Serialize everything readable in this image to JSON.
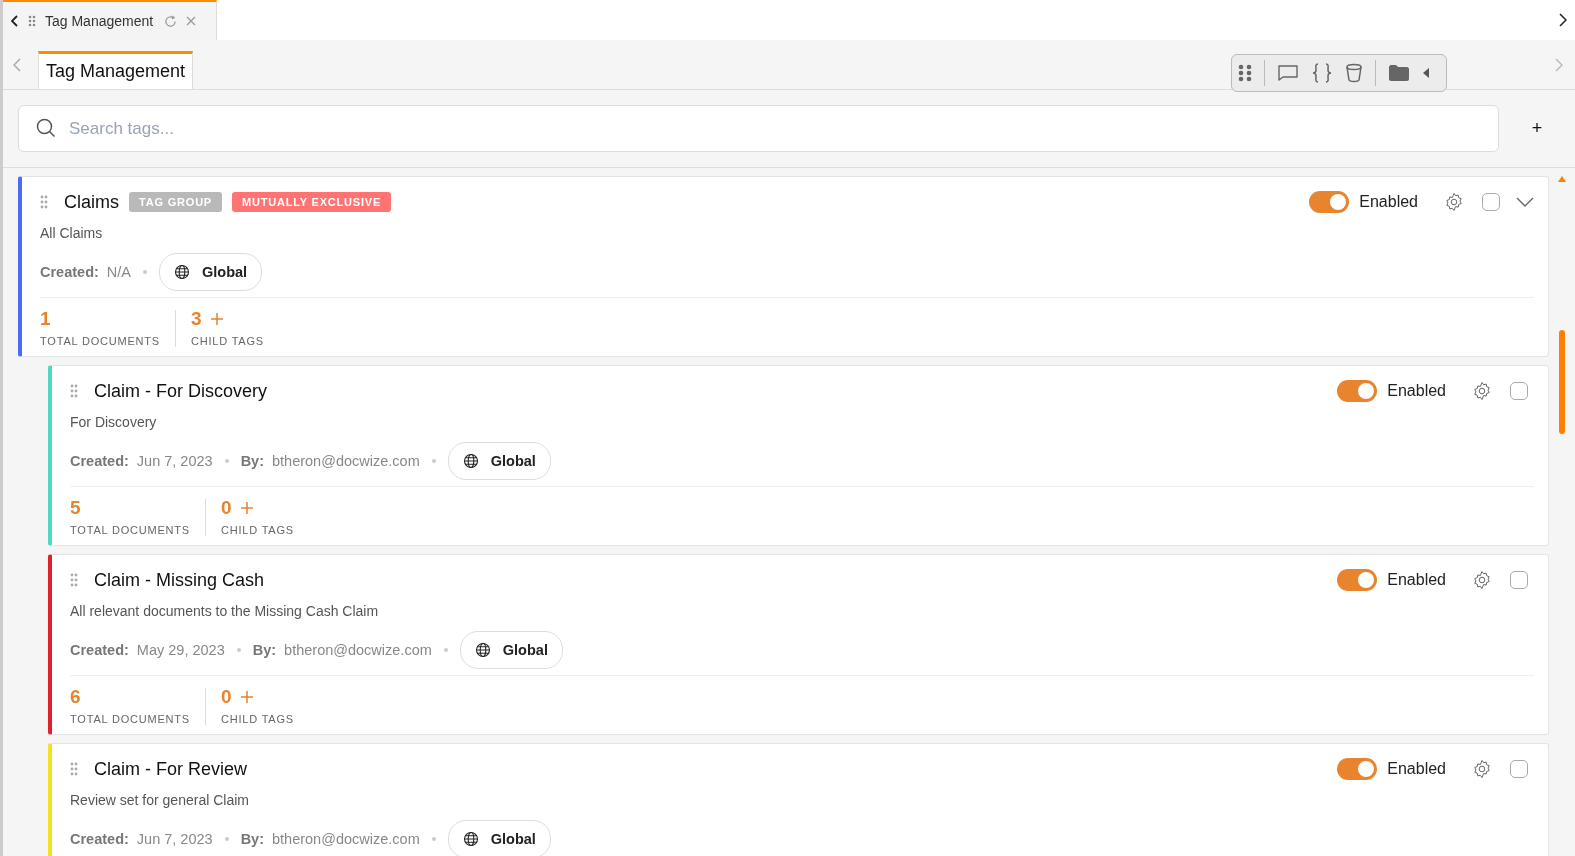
{
  "top_tab": {
    "title": "Tag Management"
  },
  "page_tab": {
    "label": "Tag Management",
    "selected": true
  },
  "search": {
    "placeholder": "Search tags..."
  },
  "add_button": "+",
  "tags": [
    {
      "name": "Claims",
      "badges": [
        {
          "text": "TAG GROUP",
          "kind": "group"
        },
        {
          "text": "MUTUALLY EXCLUSIVE",
          "kind": "exclusive"
        }
      ],
      "description": "All Claims",
      "created_label": "Created:",
      "created": "N/A",
      "scope": "Global",
      "total_documents": "1",
      "total_label": "TOTAL DOCUMENTS",
      "child_tags": "3",
      "child_label": "CHILD TAGS",
      "enabled": true,
      "status": "Enabled",
      "checked": false,
      "expanded": true,
      "color": "#4a6cf7",
      "children": [
        {
          "name": "Claim - For Discovery",
          "description": "For Discovery",
          "created_label": "Created:",
          "created": "Jun 7, 2023",
          "by_label": "By:",
          "by": "btheron@docwize.com",
          "scope": "Global",
          "total_documents": "5",
          "total_label": "TOTAL DOCUMENTS",
          "child_tags": "0",
          "child_label": "CHILD TAGS",
          "enabled": true,
          "status": "Enabled",
          "checked": false,
          "color": "#4fd8c4"
        },
        {
          "name": "Claim - Missing Cash",
          "description": "All relevant documents to the Missing Cash Claim",
          "created_label": "Created:",
          "created": "May 29, 2023",
          "by_label": "By:",
          "by": "btheron@docwize.com",
          "scope": "Global",
          "total_documents": "6",
          "total_label": "TOTAL DOCUMENTS",
          "child_tags": "0",
          "child_label": "CHILD TAGS",
          "enabled": true,
          "status": "Enabled",
          "checked": false,
          "color": "#e0202a"
        },
        {
          "name": "Claim - For Review",
          "description": "Review set for general Claim",
          "created_label": "Created:",
          "created": "Jun 7, 2023",
          "by_label": "By:",
          "by": "btheron@docwize.com",
          "scope": "Global",
          "enabled": true,
          "status": "Enabled",
          "checked": false,
          "color": "#f5e022"
        }
      ]
    }
  ]
}
